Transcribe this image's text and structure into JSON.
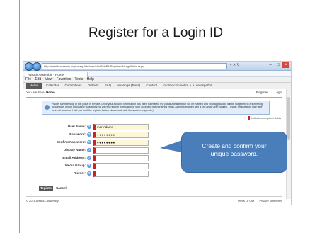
{
  "slide": {
    "title": "Register for a Login ID",
    "callout_line1": "Create  and confirm your",
    "callout_line2": "unique password."
  },
  "browser": {
    "address": "http://snatlitsassemly.org/ca.asp/cbc/uex/ModTaluPA/Register/WLegMrInts.aspx",
    "address_controls": "▾ ✕ ↻",
    "tab_title": "Associt Assembly - Home",
    "menu": [
      "File",
      "Edit",
      "View",
      "Favorites",
      "Tools",
      "Help"
    ]
  },
  "site": {
    "nav_home": "Home",
    "nav_links": [
      "Calendar",
      "Committees",
      "Districts",
      "FAQ",
      "Hearings (Tests)",
      "Contact",
      "Información sobre A.A. en español"
    ],
    "breadcrumb_prefix": "You are here:",
    "breadcrumb_current": "Home",
    "link_register": "Register",
    "link_login": "Login",
    "notice": "*Note: Membership to this portal is Private. Once your account information has been submitted, the portal Administrator will be notified and your application will be subjected to a screening procedure. If your application is authorized, you will receive notification of your access to the portal via email. All fields marked with a red arrow are required. - (Note: Registration may take several seconds. Hold you until the register button please wait until the system responds.)",
    "required_note": "Indicates required fields"
  },
  "form": {
    "fields": [
      {
        "label": "User Name:",
        "value": "mariAdams"
      },
      {
        "label": "Password:",
        "value": "●●●●●●●●"
      },
      {
        "label": "Confirm Password:",
        "value": "●●●●●●●●"
      },
      {
        "label": "Display Name:",
        "value": ""
      },
      {
        "label": "Email Address:",
        "value": ""
      },
      {
        "label": "Media Group:",
        "value": ""
      },
      {
        "label": "District:",
        "value": ""
      }
    ],
    "register_label": "Register",
    "cancel_label": "Cancel"
  },
  "footer": {
    "copyright": "© 2011 Area 44 Assembly",
    "terms": "Terms Of Use",
    "privacy": "Privacy Statement"
  },
  "colors": {
    "callout": "#4a7ebb",
    "required_marker": "#cc2222",
    "notice_bg": "#e3edf9"
  }
}
